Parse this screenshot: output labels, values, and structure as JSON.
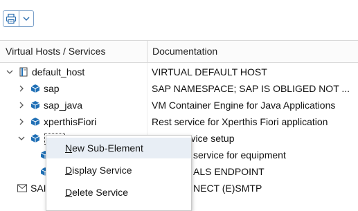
{
  "toolbar": {
    "buttons": [
      {
        "icon": "print-icon"
      },
      {
        "icon": "chevron-down-icon"
      }
    ]
  },
  "table": {
    "columns": [
      "Virtual Hosts / Services",
      "Documentation"
    ],
    "rows": [
      {
        "name": "default_host",
        "doc": "VIRTUAL DEFAULT HOST",
        "expanded": true,
        "icon": "host-icon"
      },
      {
        "name": "sap",
        "doc": "SAP NAMESPACE; SAP IS OBLIGED NOT ...",
        "expanded": false,
        "icon": "service-cube-icon"
      },
      {
        "name": "sap_java",
        "doc": "VM Container Engine for Java Applications",
        "expanded": false,
        "icon": "service-cube-icon"
      },
      {
        "name": "xperthisFiori",
        "doc": "Rest service for Xperthis Fiori application",
        "expanded": false,
        "icon": "service-cube-icon"
      },
      {
        "name": "z",
        "doc": "ervice setup",
        "expanded": true,
        "icon": "service-cube-icon"
      },
      {
        "name": "",
        "doc": "service for equipment",
        "icon": "service-cube-icon"
      },
      {
        "name": "",
        "doc": "ALS ENDPOINT",
        "icon": "service-cube-icon"
      },
      {
        "name": "SAI",
        "doc": "NECT (E)SMTP",
        "icon": "mail-icon"
      }
    ]
  },
  "context_menu": {
    "items": [
      {
        "first": "N",
        "rest": "ew Sub-Element",
        "highlighted": true
      },
      {
        "first": "D",
        "rest": "isplay Service",
        "highlighted": false
      },
      {
        "first": "D",
        "rest": "elete Service",
        "highlighted": false
      }
    ]
  },
  "colors": {
    "accent_blue": "#1f6fb5",
    "border": "#d9d9d9",
    "menu_highlight": "#e8eef5"
  }
}
